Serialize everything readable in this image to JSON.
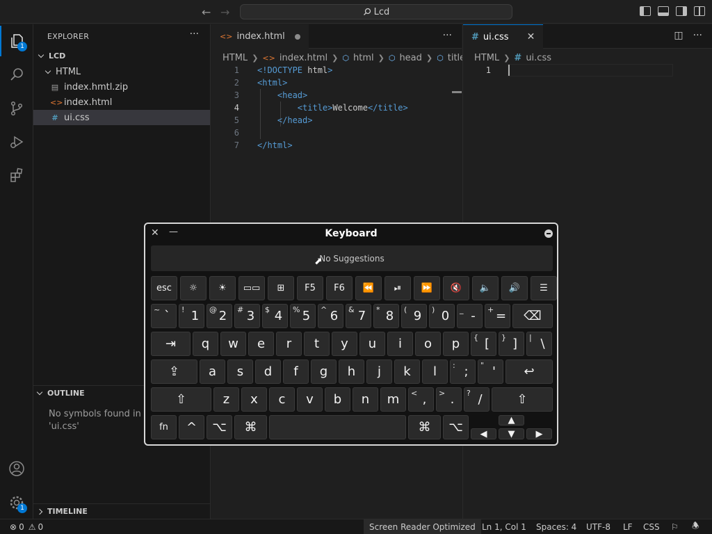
{
  "titlebar": {
    "search": "Lcd",
    "back_icon": "arrow-left-icon",
    "forward_icon": "arrow-right-icon"
  },
  "activity": {
    "explorer_badge": "1",
    "settings_badge": "1"
  },
  "sidebar": {
    "title": "EXPLORER",
    "root": "LCD",
    "folder": "HTML",
    "files": [
      {
        "name": "index.hmtl.zip",
        "icon": "file-icon"
      },
      {
        "name": "index.html",
        "icon": "html-file-icon"
      },
      {
        "name": "ui.css",
        "icon": "css-file-icon"
      }
    ],
    "outline_title": "OUTLINE",
    "outline_msg_1": "No symbols found in d",
    "outline_msg_2": "'ui.css'",
    "timeline_title": "TIMELINE"
  },
  "editor1": {
    "tab": "index.html",
    "breadcrumb": [
      "HTML",
      "index.html",
      "html",
      "head",
      "title"
    ],
    "lines": [
      {
        "n": "1",
        "parts": [
          {
            "t": "<!DOCTYPE ",
            "c": "tag"
          },
          {
            "t": "html",
            "c": "txt"
          },
          {
            "t": ">",
            "c": "tag"
          }
        ]
      },
      {
        "n": "2",
        "parts": [
          {
            "t": "<html>",
            "c": "tag"
          }
        ]
      },
      {
        "n": "3",
        "parts": [
          {
            "t": "    <head>",
            "c": "tag"
          }
        ]
      },
      {
        "n": "4",
        "parts": [
          {
            "t": "        <title>",
            "c": "tag"
          },
          {
            "t": "Welcome",
            "c": "txt"
          },
          {
            "t": "</title>",
            "c": "tag"
          }
        ]
      },
      {
        "n": "5",
        "parts": [
          {
            "t": "    </head>",
            "c": "tag"
          }
        ]
      },
      {
        "n": "6",
        "parts": []
      },
      {
        "n": "7",
        "parts": [
          {
            "t": "</html>",
            "c": "tag"
          }
        ]
      }
    ]
  },
  "editor2": {
    "tab": "ui.css",
    "breadcrumb": [
      "HTML",
      "ui.css"
    ],
    "line_number": "1"
  },
  "keyboard": {
    "title": "Keyboard",
    "suggestions": "No Suggestions",
    "fn_row": [
      "esc",
      "☼",
      "☀",
      "▭▭",
      "⊞",
      "F5",
      "F6",
      "⏪",
      "⏯",
      "⏩",
      "🔇",
      "🔈",
      "🔊",
      "☰"
    ],
    "row1": [
      [
        "~",
        "`"
      ],
      [
        "!",
        "1"
      ],
      [
        "@",
        "2"
      ],
      [
        "#",
        "3"
      ],
      [
        "$",
        "4"
      ],
      [
        "%",
        "5"
      ],
      [
        "^",
        "6"
      ],
      [
        "&",
        "7"
      ],
      [
        "*",
        "8"
      ],
      [
        "(",
        "9"
      ],
      [
        ")",
        "0"
      ],
      [
        "_",
        "-"
      ],
      [
        "+",
        "="
      ]
    ],
    "backspace": "⌫",
    "tab": "⇥",
    "row2": [
      "q",
      "w",
      "e",
      "r",
      "t",
      "y",
      "u",
      "i",
      "o",
      "p"
    ],
    "row2_brackets": [
      [
        "{",
        "["
      ],
      [
        "}",
        "]"
      ],
      [
        "|",
        "\\"
      ]
    ],
    "caps": "⇪",
    "row3": [
      "a",
      "s",
      "d",
      "f",
      "g",
      "h",
      "j",
      "k",
      "l"
    ],
    "row3_punct": [
      [
        ":",
        ";"
      ],
      [
        "\"",
        "'"
      ]
    ],
    "enter": "↩",
    "shift": "⇧",
    "row4": [
      "z",
      "x",
      "c",
      "v",
      "b",
      "n",
      "m"
    ],
    "row4_punct": [
      [
        "<",
        ","
      ],
      [
        ">",
        "."
      ],
      [
        "?",
        "/"
      ]
    ],
    "fn": "fn",
    "ctrl": "^",
    "opt": "⌥",
    "cmd": "⌘",
    "arrows": [
      "▲",
      "◀",
      "▼",
      "▶"
    ]
  },
  "statusbar": {
    "errors": "0",
    "warnings": "0",
    "screen_reader": "Screen Reader Optimized",
    "position": "Ln 1, Col 1",
    "spaces": "Spaces: 4",
    "encoding": "UTF-8",
    "eol": "LF",
    "language": "CSS"
  }
}
